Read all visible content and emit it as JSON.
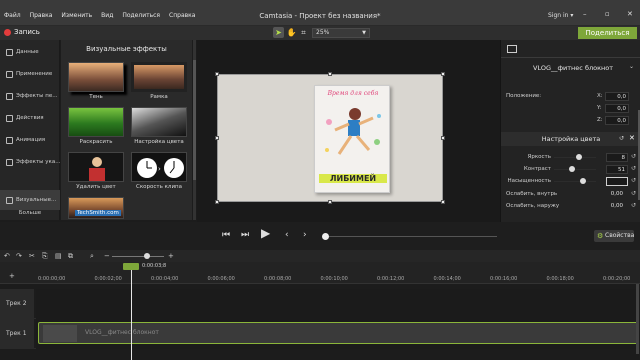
{
  "titlebar": {
    "menu": [
      "Файл",
      "Правка",
      "Изменить",
      "Вид",
      "Поделиться",
      "Справка"
    ],
    "title": "Camtasia - Проект без названия*",
    "signin": "Sign in",
    "minimize": "–",
    "maximize": "▫",
    "close": "✕"
  },
  "toolbar": {
    "record_label": "Запись",
    "zoom_value": "25%",
    "share_label": "Поделиться"
  },
  "rail": {
    "items": [
      "Данные",
      "Применение",
      "Эффекты пе...",
      "Действия",
      "Анимация",
      "Эффекты ука...",
      "Визуальные..."
    ],
    "more_label": "Больше"
  },
  "effects_panel": {
    "title": "Визуальные эффекты",
    "effects": [
      "Тень",
      "Рамка",
      "Раскрасить",
      "Настройка цвета",
      "Удалить цвет",
      "Скорость клипа",
      "TechSmith.com"
    ]
  },
  "canvas": {
    "book_title_top": "Время для себя",
    "book_title_bottom": "ЛИБИМЕЙ"
  },
  "properties": {
    "clip_name": "VLOG__фитнес блокнот",
    "position_label": "Положение:",
    "position": [
      {
        "axis": "X:",
        "value": "0,0"
      },
      {
        "axis": "Y:",
        "value": "0,0"
      },
      {
        "axis": "Z:",
        "value": "0,0"
      }
    ],
    "color_adjust_title": "Настройка цвета",
    "sliders": [
      {
        "label": "Яркость",
        "value": "8",
        "level": 0.6
      },
      {
        "label": "Контраст",
        "value": "51",
        "level": 0.42
      },
      {
        "label": "Насыщенность",
        "value": "",
        "level": 0.7
      }
    ],
    "extras": [
      {
        "label": "Ослабить, внутрь",
        "value": "0,00"
      },
      {
        "label": "Ослабить, наружу",
        "value": "0,00"
      }
    ]
  },
  "playback": {
    "properties_label": "Свойства",
    "progress": 0.0
  },
  "timeline": {
    "playhead_time": "0:00:03;8",
    "ruler": [
      "0:00:00;00",
      "0:00:02;00",
      "0:00:04;00",
      "0:00:06;00",
      "0:00:08;00",
      "0:00:10;00",
      "0:00:12;00",
      "0:00:14;00",
      "0:00:16;00",
      "0:00:18;00",
      "0:00:20;00"
    ],
    "tracks": [
      "Трек 2",
      "Трек 1"
    ],
    "clip_label": "VLOG__фитнес блокнот"
  },
  "colors": {
    "accent_green": "#7ea73a",
    "record_red": "#e33c3c"
  }
}
